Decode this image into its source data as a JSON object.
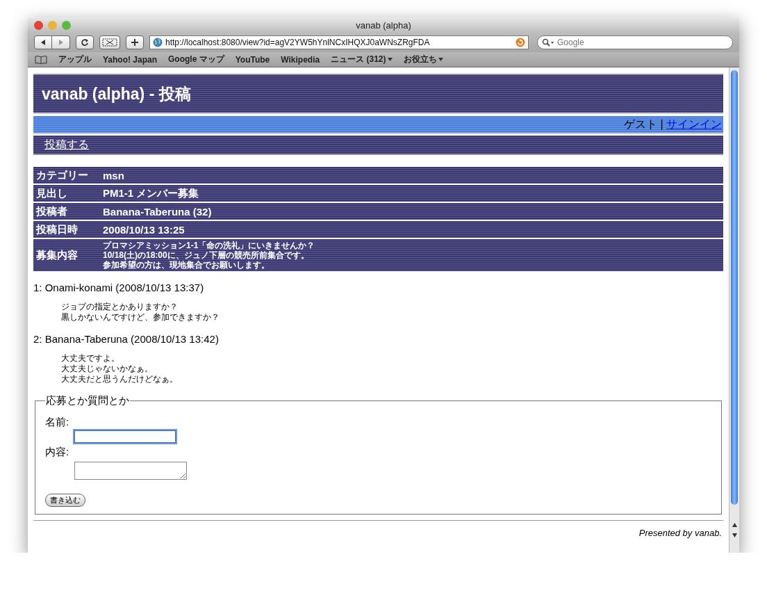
{
  "window": {
    "title": "vanab (alpha)"
  },
  "toolbar": {
    "url": "http://localhost:8080/view?id=agV2YW5hYnlNCxIHQXJ0aWNsZRgFDA",
    "search": {
      "placeholder": "Google"
    }
  },
  "bookmarks": [
    {
      "label": "アップル",
      "menu": false
    },
    {
      "label": "Yahoo! Japan",
      "menu": false
    },
    {
      "label": "Google マップ",
      "menu": false
    },
    {
      "label": "YouTube",
      "menu": false
    },
    {
      "label": "Wikipedia",
      "menu": false
    },
    {
      "label": "ニュース (312)",
      "menu": true
    },
    {
      "label": "お役立ち",
      "menu": true
    }
  ],
  "page": {
    "title": "vanab (alpha) - 投稿",
    "user": {
      "text": "ゲスト |",
      "link": "サインイン"
    },
    "nav": [
      "投稿する"
    ],
    "details": [
      {
        "label": "カテゴリー",
        "lines": [
          "msn"
        ]
      },
      {
        "label": "見出し",
        "lines": [
          "PM1-1 メンバー募集"
        ]
      },
      {
        "label": "投稿者",
        "lines": [
          "Banana-Taberuna (32)"
        ]
      },
      {
        "label": "投稿日時",
        "lines": [
          "2008/10/13 13:25"
        ]
      },
      {
        "label": "募集内容",
        "lines": [
          "プロマシアミッション1-1「命の洗礼」にいきませんか？",
          "10/18(土)の18:00に、ジュノ下層の競売所前集合です。",
          "参加希望の方は、現地集合でお願いします。"
        ]
      }
    ],
    "comments": [
      {
        "header": "1: Onami-konami (2008/10/13 13:37)",
        "lines": [
          "ジョブの指定とかありますか？",
          "黒しかないんですけど、参加できますか？"
        ]
      },
      {
        "header": "2: Banana-Taberuna (2008/10/13 13:42)",
        "lines": [
          "大丈夫ですよ。",
          "大丈夫じゃないかなぁ。",
          "大丈夫だと思うんだけどなぁ。"
        ]
      }
    ],
    "form": {
      "legend": "応募とか質問とか",
      "fields": [
        {
          "label": "名前:",
          "kind": "input",
          "focused": true
        },
        {
          "label": "内容:",
          "kind": "textarea",
          "focused": false
        }
      ],
      "submit": "書き込む"
    },
    "footer": "Presented by vanab."
  }
}
